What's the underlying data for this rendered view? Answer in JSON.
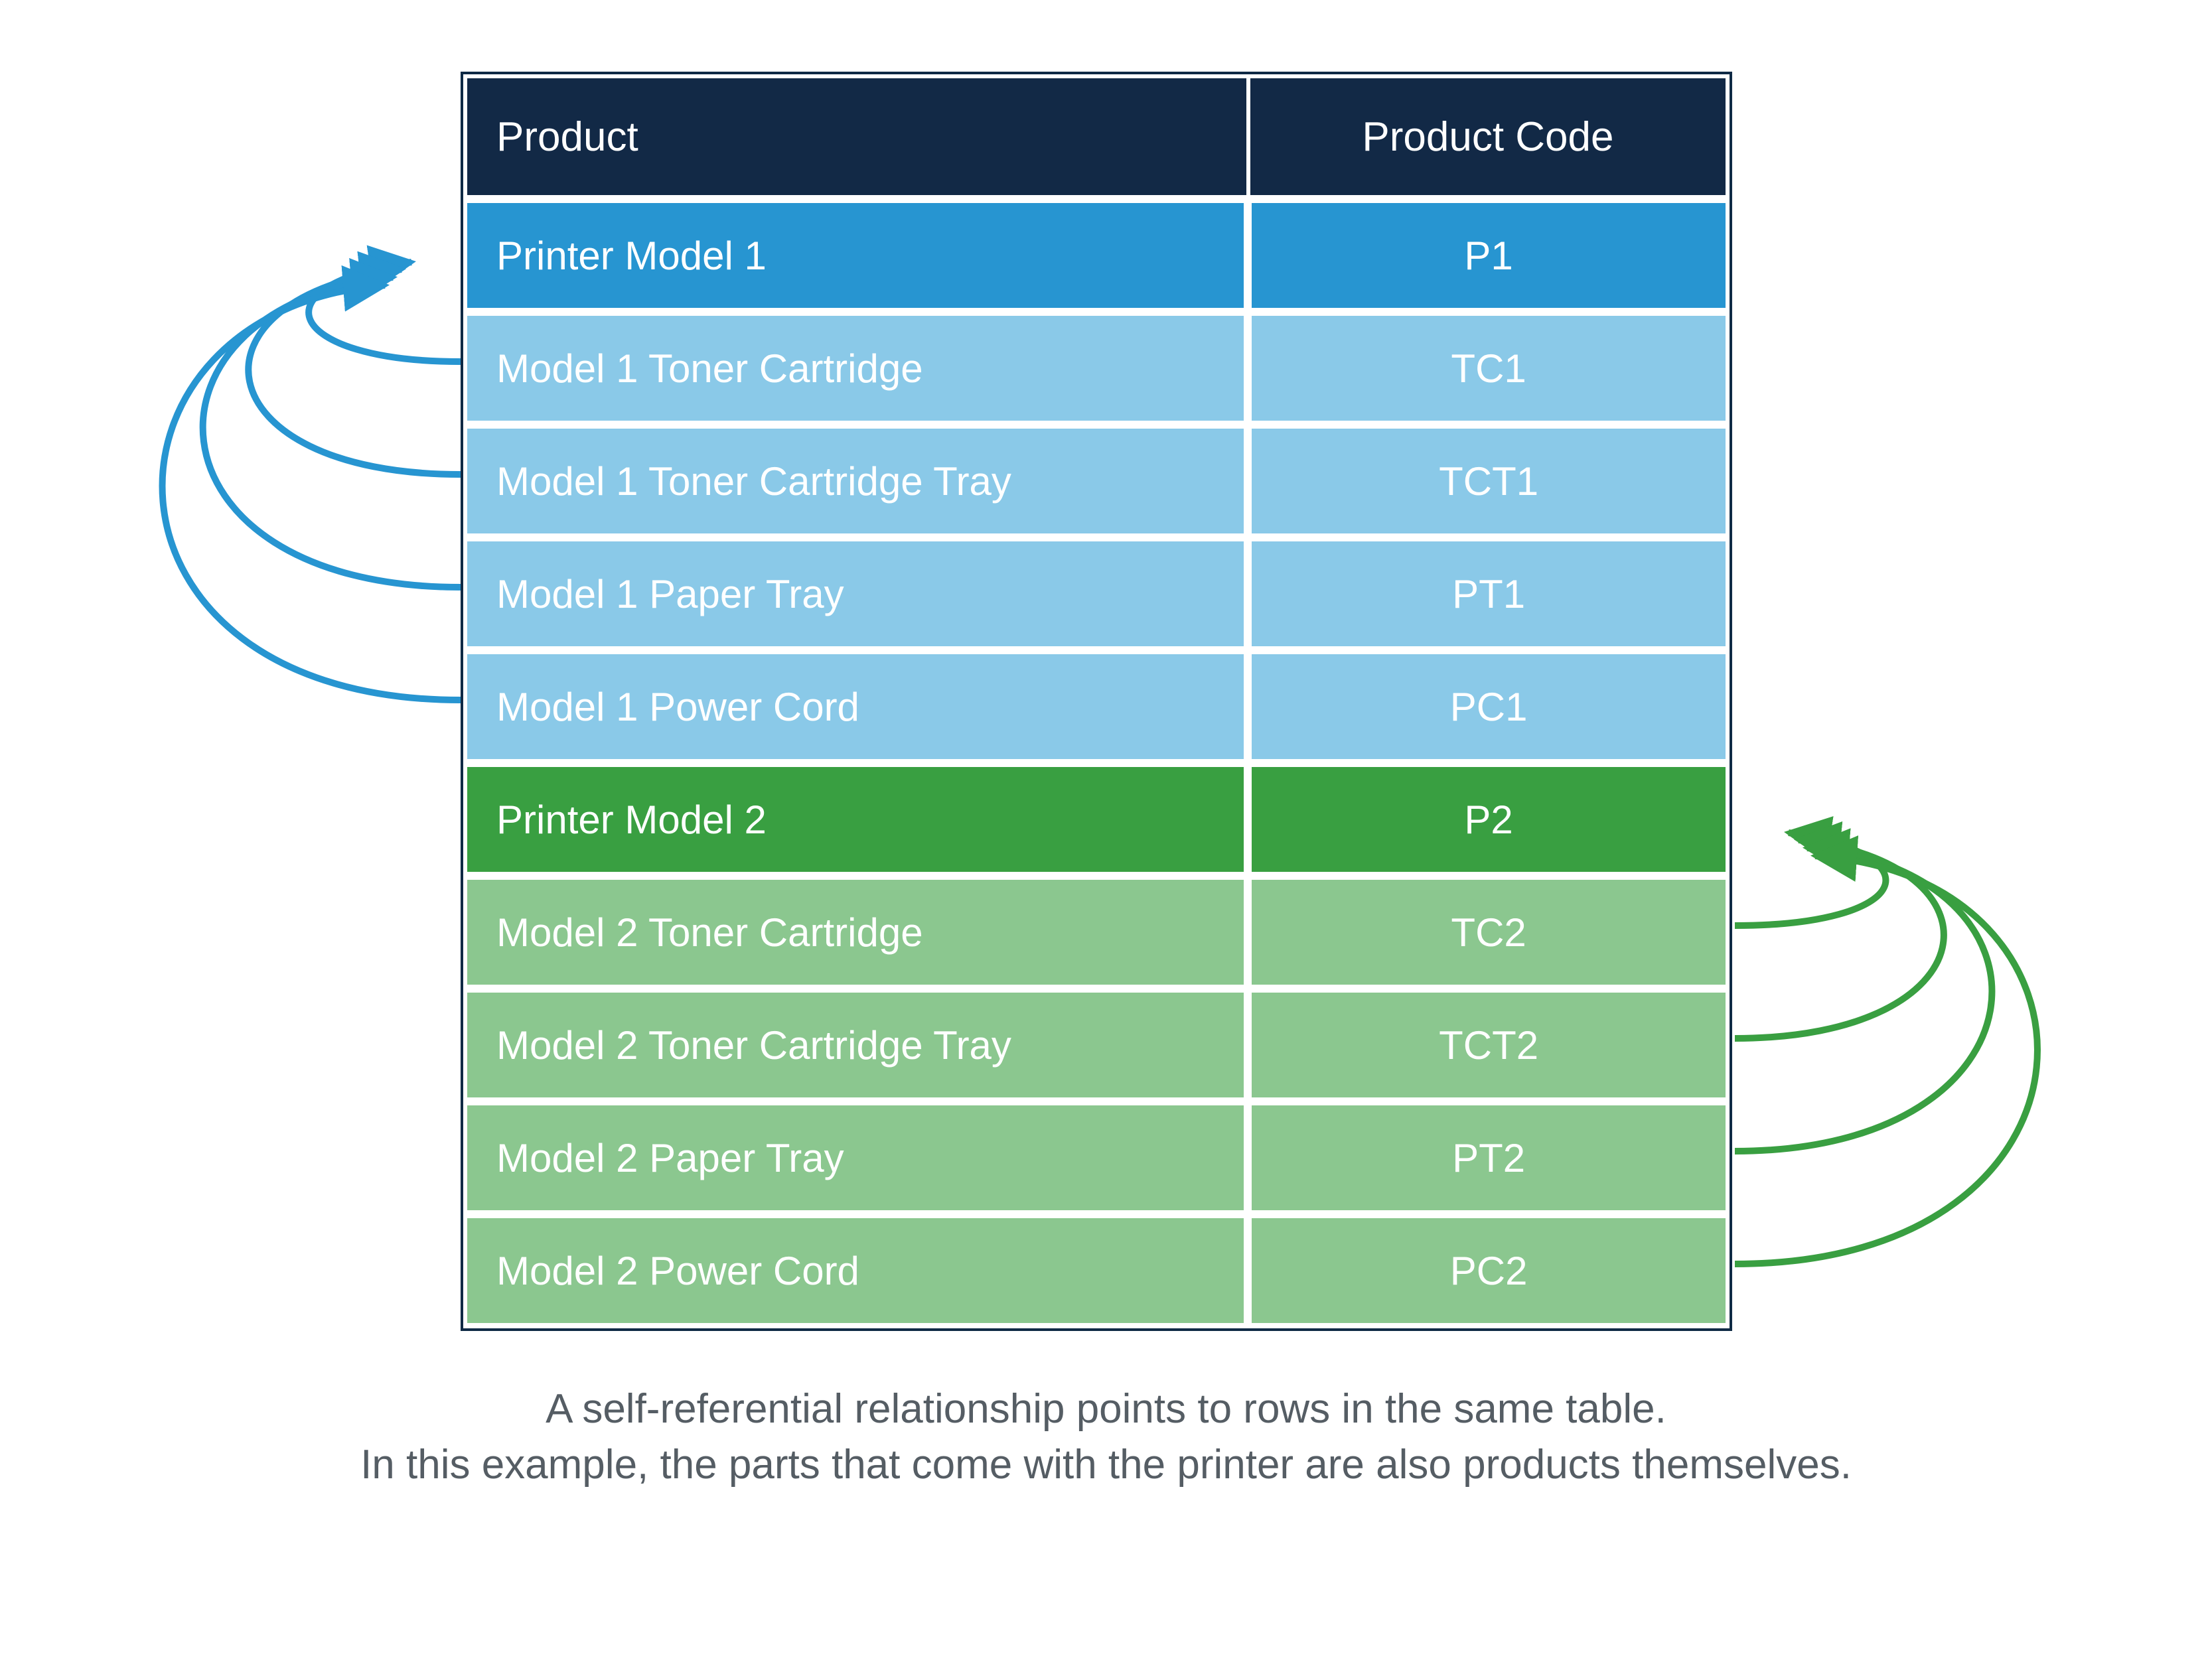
{
  "columns": {
    "product": "Product",
    "code": "Product Code"
  },
  "rows": [
    {
      "kind": "parent-blue",
      "product": "Printer Model 1",
      "code": "P1"
    },
    {
      "kind": "child-blue",
      "product": "Model 1 Toner Cartridge",
      "code": "TC1"
    },
    {
      "kind": "child-blue",
      "product": "Model 1 Toner Cartridge Tray",
      "code": "TCT1"
    },
    {
      "kind": "child-blue",
      "product": "Model 1 Paper Tray",
      "code": "PT1"
    },
    {
      "kind": "child-blue",
      "product": "Model 1 Power Cord",
      "code": "PC1"
    },
    {
      "kind": "parent-green",
      "product": "Printer Model 2",
      "code": "P2"
    },
    {
      "kind": "child-green",
      "product": "Model 2 Toner Cartridge",
      "code": "TC2"
    },
    {
      "kind": "child-green",
      "product": "Model 2 Toner Cartridge Tray",
      "code": "TCT2"
    },
    {
      "kind": "child-green",
      "product": "Model 2 Paper Tray",
      "code": "PT2"
    },
    {
      "kind": "child-green",
      "product": "Model 2 Power Cord",
      "code": "PC2"
    }
  ],
  "caption": {
    "line1": "A self-referential relationship points to rows in the same table.",
    "line2": "In this example, the parts that come with the printer are also products themselves."
  },
  "colors": {
    "blue": "#2795d1",
    "green": "#399f41"
  }
}
